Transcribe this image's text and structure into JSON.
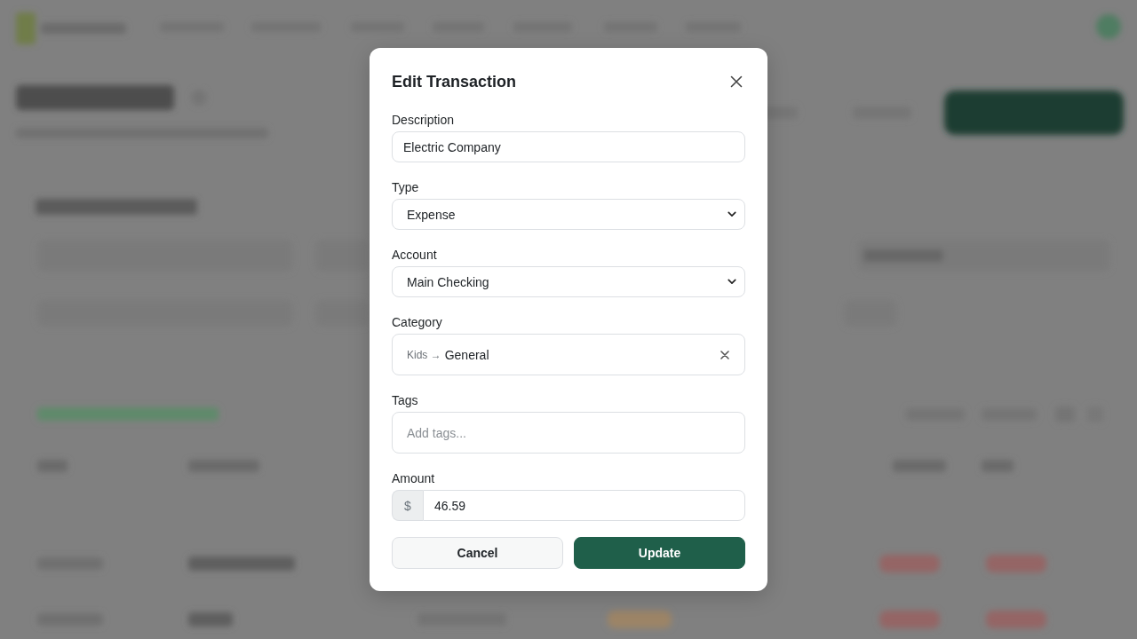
{
  "dialog": {
    "title": "Edit Transaction",
    "fields": [
      {
        "kind": "text",
        "label": "Description",
        "value": "Electric Company"
      },
      {
        "kind": "select",
        "label": "Type",
        "value": "Expense"
      },
      {
        "kind": "select",
        "label": "Account",
        "value": "Main Checking"
      },
      {
        "kind": "category",
        "label": "Category",
        "parent": "Kids →",
        "value": "General"
      },
      {
        "kind": "tags",
        "label": "Tags",
        "placeholder": "Add tags..."
      },
      {
        "kind": "amount",
        "label": "Amount",
        "prefix": "$",
        "value": "46.59"
      }
    ],
    "buttons": [
      {
        "kind": "secondary",
        "label": "Cancel"
      },
      {
        "kind": "primary",
        "label": "Update"
      }
    ]
  }
}
